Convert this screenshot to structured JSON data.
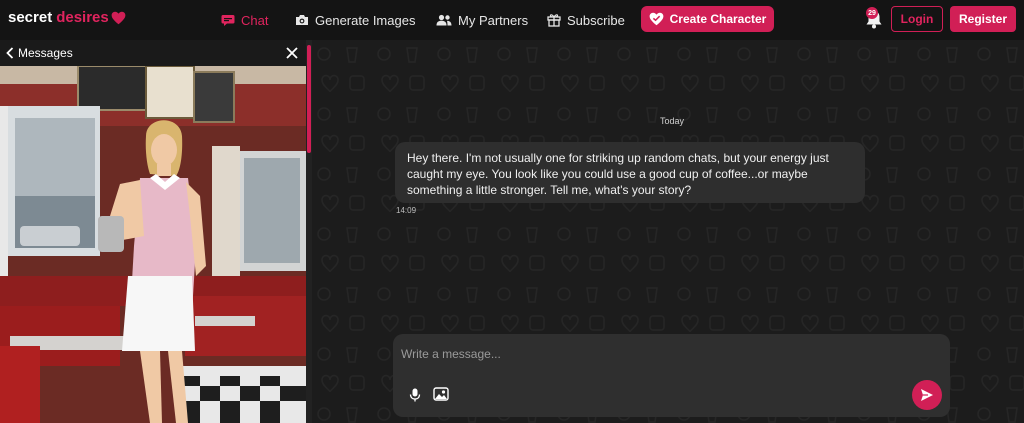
{
  "brand": {
    "part1": "secret",
    "part2": "desires",
    "accent": "#d11f56"
  },
  "nav": {
    "chat": "Chat",
    "generate_images": "Generate Images",
    "my_partners": "My Partners",
    "subscribe": "Subscribe",
    "create_character": "Create Character"
  },
  "notifications": {
    "count": "29"
  },
  "auth": {
    "login": "Login",
    "register": "Register"
  },
  "sidebar": {
    "back_label": "Messages"
  },
  "chat": {
    "day_label": "Today",
    "messages": [
      {
        "text": "Hey there. I'm not usually one for striking up random chats, but your energy just caught my eye. You look like you could use a good cup of coffee...or maybe something a little stronger. Tell me, what's your story?",
        "time": "14:09"
      }
    ],
    "composer": {
      "placeholder": "Write a message..."
    }
  },
  "icons": {
    "chat": "chat-bubble-icon",
    "generate_images": "camera-icon",
    "partners": "users-icon",
    "subscribe": "gift-icon",
    "create": "heart-plus-icon",
    "bell": "bell-icon",
    "back": "chevron-left-icon",
    "close": "close-icon",
    "mic": "microphone-icon",
    "image": "image-icon",
    "send": "send-icon"
  }
}
